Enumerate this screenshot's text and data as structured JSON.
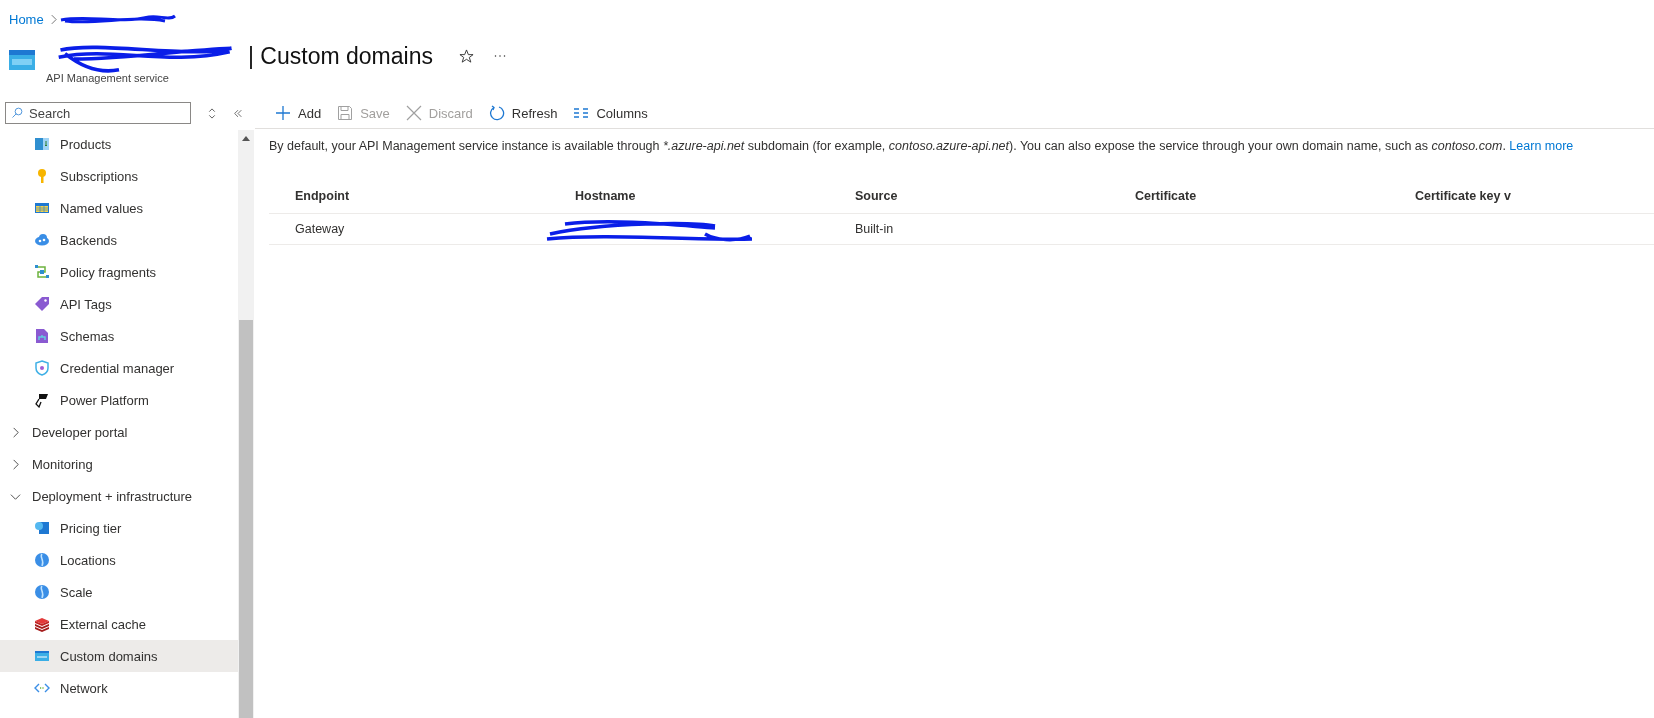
{
  "breadcrumb": [
    {
      "label": "Home"
    }
  ],
  "header": {
    "title": "| Custom domains",
    "subtitle": "API Management service",
    "favorite": false
  },
  "sidebar": {
    "search": {
      "placeholder": "Search"
    },
    "items": [
      {
        "label": "Products",
        "kind": "products",
        "selected": false
      },
      {
        "label": "Subscriptions",
        "kind": "key",
        "selected": false
      },
      {
        "label": "Named values",
        "kind": "table",
        "selected": false
      },
      {
        "label": "Backends",
        "kind": "cloud",
        "selected": false
      },
      {
        "label": "Policy fragments",
        "kind": "fragments",
        "selected": false
      },
      {
        "label": "API Tags",
        "kind": "tag",
        "selected": false
      },
      {
        "label": "Schemas",
        "kind": "schema",
        "selected": false
      },
      {
        "label": "Credential manager",
        "kind": "shield",
        "selected": false
      },
      {
        "label": "Power Platform",
        "kind": "power",
        "selected": false
      },
      {
        "label": "Developer portal",
        "kind": "group",
        "expanded": false
      },
      {
        "label": "Monitoring",
        "kind": "group",
        "expanded": false
      },
      {
        "label": "Deployment + infrastructure",
        "kind": "group",
        "expanded": true,
        "children": [
          {
            "label": "Pricing tier",
            "kind": "pricing",
            "selected": false
          },
          {
            "label": "Locations",
            "kind": "globe",
            "selected": false
          },
          {
            "label": "Scale",
            "kind": "globe",
            "selected": false
          },
          {
            "label": "External cache",
            "kind": "cache",
            "selected": false
          },
          {
            "label": "Custom domains",
            "kind": "www",
            "selected": true
          },
          {
            "label": "Network",
            "kind": "network",
            "selected": false
          }
        ]
      }
    ]
  },
  "toolbar": [
    {
      "label": "Add",
      "kind": "plus",
      "disabled": false
    },
    {
      "label": "Save",
      "kind": "save",
      "disabled": true
    },
    {
      "label": "Discard",
      "kind": "x",
      "disabled": true
    },
    {
      "label": "Refresh",
      "kind": "refresh",
      "disabled": false
    },
    {
      "label": "Columns",
      "kind": "columns",
      "disabled": false
    }
  ],
  "info": {
    "parts": [
      {
        "text": "By default, your API Management service instance is available through ",
        "italic": false
      },
      {
        "text": "*.azure-api.net",
        "italic": true
      },
      {
        "text": " subdomain (for example, ",
        "italic": false
      },
      {
        "text": "contoso.azure-api.net",
        "italic": true
      },
      {
        "text": "). You can also expose the service through your own domain name, such as ",
        "italic": false
      },
      {
        "text": "contoso.com",
        "italic": true
      },
      {
        "text": ".",
        "italic": false
      }
    ],
    "link": "Learn more"
  },
  "table": {
    "columns": [
      "Endpoint",
      "Hostname",
      "Source",
      "Certificate",
      "Certificate key v"
    ],
    "rows": [
      [
        "Gateway",
        "",
        "Built-in",
        "",
        ""
      ]
    ]
  }
}
